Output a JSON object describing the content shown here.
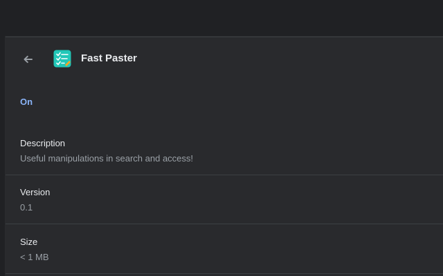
{
  "extension": {
    "name": "Fast Paster",
    "icon": "clipboard-checklist-icon",
    "status": "On"
  },
  "details": {
    "description_label": "Description",
    "description_value": "Useful manipulations in search and access!",
    "version_label": "Version",
    "version_value": "0.1",
    "size_label": "Size",
    "size_value": "< 1 MB"
  },
  "colors": {
    "background": "#202124",
    "card": "#292a2d",
    "status": "#8ab4f8",
    "text": "#e8eaed",
    "secondary_text": "#9aa0a6"
  }
}
